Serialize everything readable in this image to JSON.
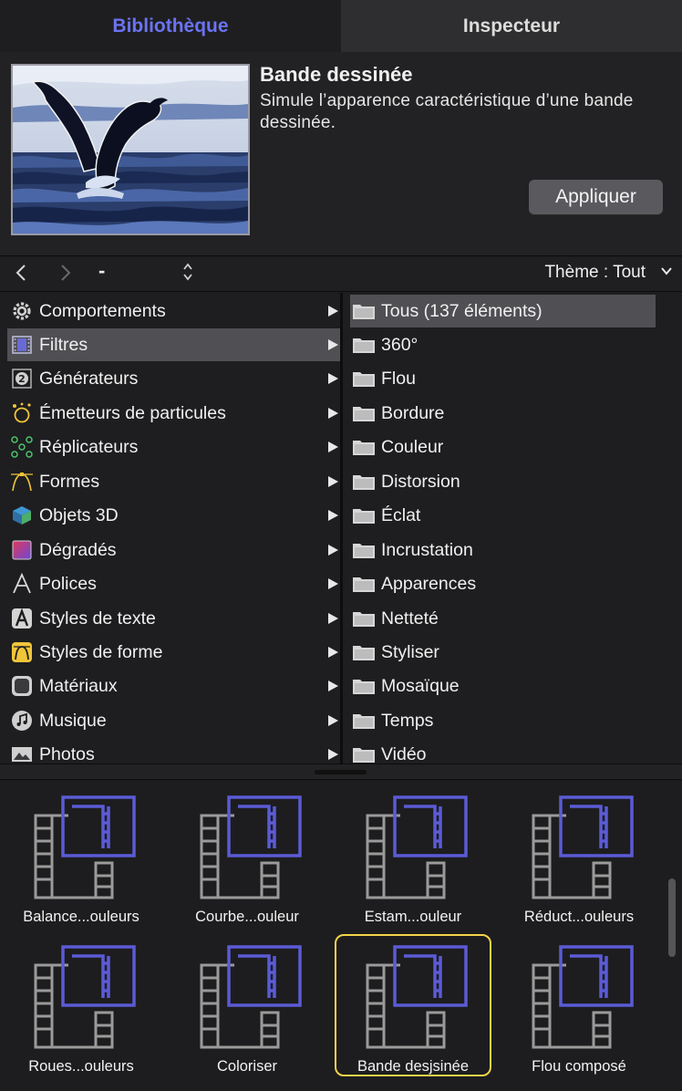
{
  "tabs": {
    "library": "Bibliothèque",
    "inspector": "Inspecteur"
  },
  "preview": {
    "title": "Bande dessinée",
    "description": "Simule l’apparence caractéristique d’une bande dessinée.",
    "apply_label": "Appliquer"
  },
  "nav": {
    "back": "<",
    "forward": ">",
    "path": "-",
    "theme_label": "Thème : Tout"
  },
  "categories": [
    {
      "label": "Comportements",
      "icon": "gear-icon"
    },
    {
      "label": "Filtres",
      "icon": "filmstrip-icon",
      "selected": true
    },
    {
      "label": "Générateurs",
      "icon": "generator-icon"
    },
    {
      "label": "Émetteurs de particules",
      "icon": "particle-emitter-icon"
    },
    {
      "label": "Réplicateurs",
      "icon": "replicator-icon"
    },
    {
      "label": "Formes",
      "icon": "shape-icon"
    },
    {
      "label": "Objets 3D",
      "icon": "cube-icon"
    },
    {
      "label": "Dégradés",
      "icon": "gradient-icon"
    },
    {
      "label": "Polices",
      "icon": "font-icon"
    },
    {
      "label": "Styles de texte",
      "icon": "text-style-icon"
    },
    {
      "label": "Styles de forme",
      "icon": "shape-style-icon"
    },
    {
      "label": "Matériaux",
      "icon": "material-icon"
    },
    {
      "label": "Musique",
      "icon": "music-icon"
    },
    {
      "label": "Photos",
      "icon": "photo-icon"
    }
  ],
  "subcategories": [
    {
      "label": "Tous (137 éléments)",
      "selected": true
    },
    {
      "label": "360°"
    },
    {
      "label": "Flou"
    },
    {
      "label": "Bordure"
    },
    {
      "label": "Couleur"
    },
    {
      "label": "Distorsion"
    },
    {
      "label": "Éclat"
    },
    {
      "label": "Incrustation"
    },
    {
      "label": "Apparences"
    },
    {
      "label": "Netteté"
    },
    {
      "label": "Styliser"
    },
    {
      "label": "Mosaïque"
    },
    {
      "label": "Temps"
    },
    {
      "label": "Vidéo"
    }
  ],
  "items": [
    {
      "label": "Balance...ouleurs"
    },
    {
      "label": "Courbe...ouleur"
    },
    {
      "label": "Estam...ouleur"
    },
    {
      "label": "Réduct...ouleurs"
    },
    {
      "label": "Roues...ouleurs"
    },
    {
      "label": "Coloriser"
    },
    {
      "label": "Bande desjsinée",
      "selected": true
    },
    {
      "label": "Flou composé"
    }
  ],
  "colors": {
    "accent": "#6b73f2",
    "selection_highlight": "#f5d34a",
    "filter_icon_blue": "#5b5bd6",
    "filter_icon_gray": "#9a9a9a"
  }
}
